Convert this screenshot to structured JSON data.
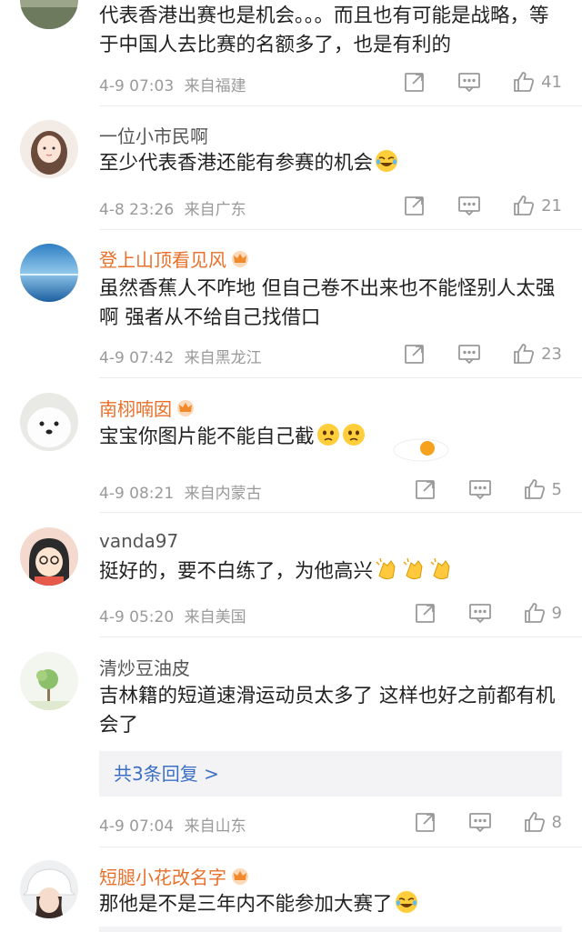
{
  "comments": [
    {
      "name": "",
      "text": "代表香港出赛也是机会。。。而且也有可能是战略，等于中国人去比赛的名额多了，也是有利的",
      "time": "4-9 07:03",
      "location": "来自福建",
      "likes": "41"
    },
    {
      "name": "一位小市民啊",
      "text": "至少代表香港还能有参赛的机会",
      "time": "4-8 23:26",
      "location": "来自广东",
      "likes": "21"
    },
    {
      "name": "登上山顶看见风",
      "text": "虽然香蕉人不咋地 但自己卷不出来也不能怪别人太强啊 强者从不给自己找借口",
      "time": "4-9 07:42",
      "location": "来自黑龙江",
      "likes": "23"
    },
    {
      "name": "南栩喃囡",
      "text": "宝宝你图片能不能自己截",
      "time": "4-9 08:21",
      "location": "来自内蒙古",
      "likes": "5"
    },
    {
      "name": "vanda97",
      "text": "挺好的，要不白练了，为他高兴",
      "time": "4-9 05:20",
      "location": "来自美国",
      "likes": "9"
    },
    {
      "name": "清炒豆油皮",
      "text": "吉林籍的短道速滑运动员太多了 这样也好之前都有机会了",
      "reply_label": "共3条回复 >",
      "time": "4-9 07:04",
      "location": "来自山东",
      "likes": "8"
    },
    {
      "name": "短腿小花改名字",
      "text": "那他是不是三年内不能参加大赛了"
    }
  ],
  "colors": {
    "vip_name": "#e8702a",
    "normal_name": "#555555",
    "link": "#3a6fc4",
    "meta": "#9a9a9a"
  },
  "icons": [
    "share-icon",
    "comment-icon",
    "like-icon",
    "crown-icon"
  ]
}
